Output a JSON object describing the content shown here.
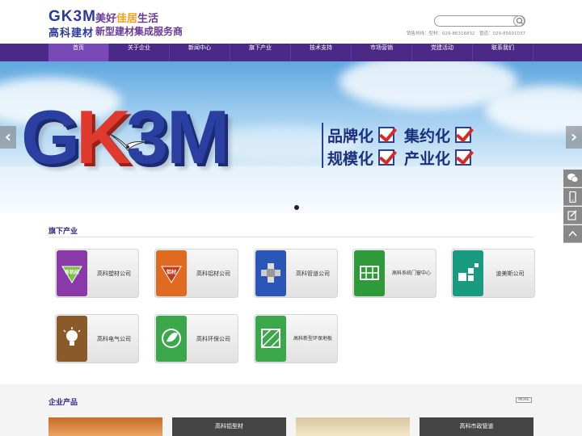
{
  "header": {
    "logo_letters": "GK3M",
    "logo_cn": "高科建材",
    "slogan_a": "美好",
    "slogan_b": "佳居",
    "slogan_c": "生活",
    "slogan_line2": "新型建材集成服务商",
    "search_placeholder": "",
    "hotline": "销售热线：型材：029-86316832　管道：029-85691037"
  },
  "nav": {
    "items": [
      "首页",
      "关于企业",
      "新闻中心",
      "旗下产业",
      "技术支持",
      "市场营销",
      "党建活动",
      "联系我们"
    ],
    "active_index": 0
  },
  "banner": {
    "logo_letters": [
      "G",
      "K",
      "3",
      "M"
    ],
    "slogans": [
      [
        "品牌化",
        "集约化"
      ],
      [
        "规模化",
        "产业化"
      ]
    ],
    "prev_glyph": "‹",
    "next_glyph": "›",
    "slide_count": 1,
    "active_slide": 1
  },
  "side_float": {
    "icons": [
      "wechat-icon",
      "mobile-icon",
      "feedback-icon",
      "back-to-top-icon"
    ]
  },
  "industries": {
    "title": "旗下产业",
    "cards": [
      {
        "label": "高科塑材公司",
        "color": "#8a3aa8",
        "icon": "plastic-profile-icon",
        "badge": "有机硅"
      },
      {
        "label": "高科铝材公司",
        "color": "#e06a1f",
        "icon": "aluminum-icon",
        "badge": "铝材"
      },
      {
        "label": "高科管道公司",
        "color": "#2a56b8",
        "icon": "pipe-fitting-icon",
        "badge": ""
      },
      {
        "label": "高科系统门窗中心",
        "color": "#2f9a3a",
        "icon": "window-grid-icon",
        "badge": ""
      },
      {
        "label": "迪美斯公司",
        "color": "#1a9a7e",
        "icon": "tiles-icon",
        "badge": ""
      },
      {
        "label": "高科电气公司",
        "color": "#8a5a2a",
        "icon": "light-bulb-icon",
        "badge": ""
      },
      {
        "label": "高科环保公司",
        "color": "#3aa84a",
        "icon": "eco-leaf-icon",
        "badge": ""
      },
      {
        "label": "高科新型环保地板",
        "color": "#3aa84a",
        "icon": "floor-icon",
        "badge": ""
      }
    ]
  },
  "products": {
    "title": "企业产品",
    "more_label": "MORE",
    "items": [
      "",
      "高科铝型材",
      "",
      "高科市政管道"
    ]
  }
}
